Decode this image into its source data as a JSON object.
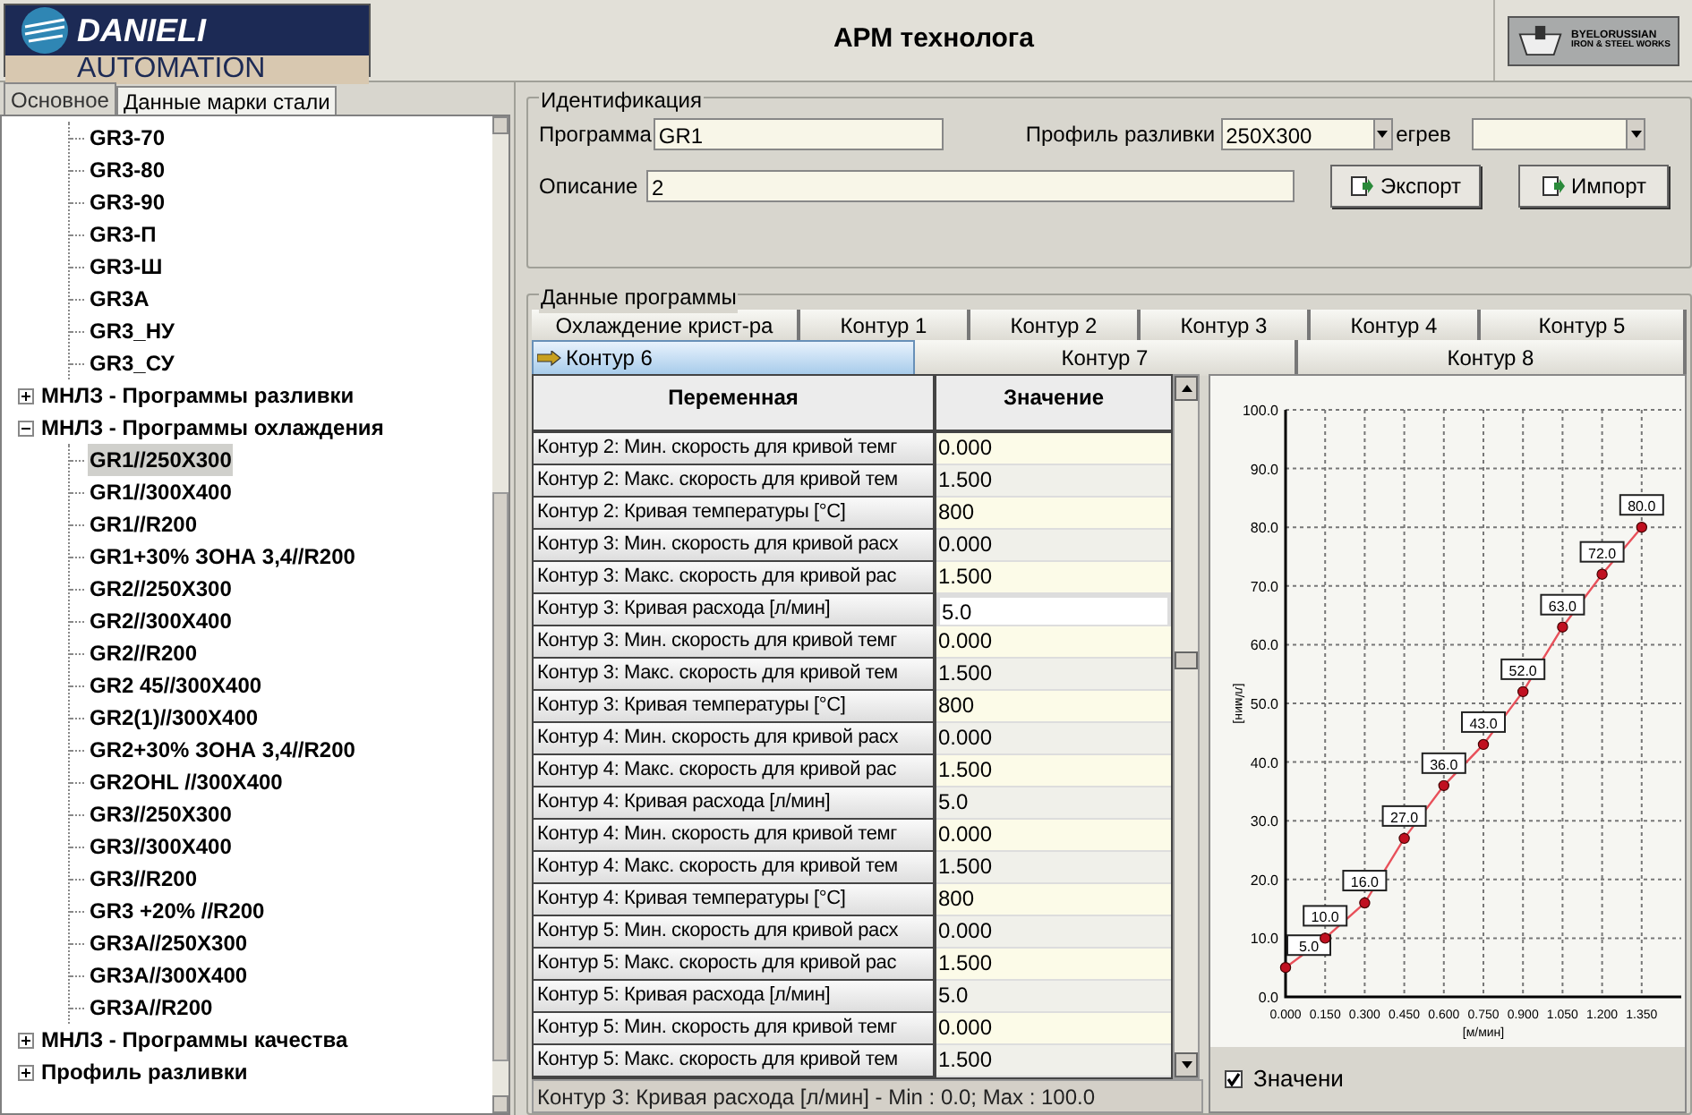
{
  "header": {
    "logo_top": "DANIELI",
    "logo_bottom": "AUTOMATION",
    "title": "АРМ технолога",
    "partner_logo": [
      "BYELORUSSIAN",
      "IRON & STEEL WORKS"
    ]
  },
  "left_tabs": [
    {
      "label": "Основное",
      "selected": true
    },
    {
      "label": "Данные марки стали",
      "selected": false
    }
  ],
  "tree": {
    "continued_children": [
      {
        "label": "GR3-70",
        "selected": false
      },
      {
        "label": "GR3-80",
        "selected": false
      },
      {
        "label": "GR3-90",
        "selected": false
      },
      {
        "label": "GR3-П",
        "selected": false
      },
      {
        "label": "GR3-Ш",
        "selected": false
      },
      {
        "label": "GR3A",
        "selected": false
      },
      {
        "label": "GR3_НУ",
        "selected": false
      },
      {
        "label": "GR3_СУ",
        "selected": false
      }
    ],
    "nodes": [
      {
        "label": "МНЛЗ - Программы разливки",
        "expanded": false
      },
      {
        "label": "МНЛЗ - Программы охлаждения",
        "expanded": true,
        "children": [
          {
            "label": "GR1//250X300",
            "selected": true
          },
          {
            "label": "GR1//300X400",
            "selected": false
          },
          {
            "label": "GR1//R200",
            "selected": false
          },
          {
            "label": "GR1+30% ЗОНА 3,4//R200",
            "selected": false
          },
          {
            "label": "GR2//250X300",
            "selected": false
          },
          {
            "label": "GR2//300X400",
            "selected": false
          },
          {
            "label": "GR2//R200",
            "selected": false
          },
          {
            "label": "GR2 45//300X400",
            "selected": false
          },
          {
            "label": "GR2(1)//300X400",
            "selected": false
          },
          {
            "label": "GR2+30% ЗОНА 3,4//R200",
            "selected": false
          },
          {
            "label": "GR2OHL //300X400",
            "selected": false
          },
          {
            "label": "GR3//250X300",
            "selected": false
          },
          {
            "label": "GR3//300X400",
            "selected": false
          },
          {
            "label": "GR3//R200",
            "selected": false
          },
          {
            "label": "GR3 +20% //R200",
            "selected": false
          },
          {
            "label": "GR3A//250X300",
            "selected": false
          },
          {
            "label": "GR3A//300X400",
            "selected": false
          },
          {
            "label": "GR3A//R200",
            "selected": false
          }
        ]
      },
      {
        "label": "МНЛЗ - Программы качества",
        "expanded": false
      },
      {
        "label": "Профиль разливки",
        "expanded": false
      }
    ]
  },
  "identification": {
    "title": "Идентификация",
    "program_label": "Программа",
    "program": "GR1",
    "profile_label": "Профиль разливки",
    "profile": "250X300",
    "heating_label": "егрев",
    "description_label": "Описание",
    "description": "2",
    "buttons": [
      "Экспорт",
      "Импорт"
    ]
  },
  "program_data": {
    "title": "Данные программы",
    "tab_rows": [
      [
        {
          "label": "Охлаждение крист-ра",
          "selected": false
        },
        {
          "label": "Контур 1",
          "selected": false
        },
        {
          "label": "Контур 2",
          "selected": false
        },
        {
          "label": "Контур 3",
          "selected": false
        },
        {
          "label": "Контур 4",
          "selected": false
        },
        {
          "label": "Контур 5",
          "selected": false
        }
      ],
      [
        {
          "label": "Контур 6",
          "selected": true
        },
        {
          "label": "Контур 7",
          "selected": false
        },
        {
          "label": "Контур 8",
          "selected": false
        }
      ]
    ],
    "table": {
      "columns": [
        "Переменная",
        "Значение"
      ],
      "rows": [
        {
          "variable": "Контур 2: Мин. скорость для кривой темг",
          "value": "0.000",
          "selected": false
        },
        {
          "variable": "Контур 2: Макс. скорость для кривой тем",
          "value": "1.500",
          "selected": false
        },
        {
          "variable": "Контур 2: Кривая температуры [°C]",
          "value": "800",
          "selected": false
        },
        {
          "variable": "Контур 3: Мин. скорость для кривой расх",
          "value": "0.000",
          "selected": false
        },
        {
          "variable": "Контур 3: Макс. скорость для кривой рас",
          "value": "1.500",
          "selected": false
        },
        {
          "variable": "Контур 3: Кривая расхода [л/мин]",
          "value": "5.0",
          "selected": true
        },
        {
          "variable": "Контур 3: Мин. скорость для кривой темг",
          "value": "0.000",
          "selected": false
        },
        {
          "variable": "Контур 3: Макс. скорость для кривой тем",
          "value": "1.500",
          "selected": false
        },
        {
          "variable": "Контур 3: Кривая температуры [°C]",
          "value": "800",
          "selected": false
        },
        {
          "variable": "Контур 4: Мин. скорость для кривой расх",
          "value": "0.000",
          "selected": false
        },
        {
          "variable": "Контур 4: Макс. скорость для кривой рас",
          "value": "1.500",
          "selected": false
        },
        {
          "variable": "Контур 4: Кривая расхода [л/мин]",
          "value": "5.0",
          "selected": false
        },
        {
          "variable": "Контур 4: Мин. скорость для кривой темг",
          "value": "0.000",
          "selected": false
        },
        {
          "variable": "Контур 4: Макс. скорость для кривой тем",
          "value": "1.500",
          "selected": false
        },
        {
          "variable": "Контур 4: Кривая температуры [°C]",
          "value": "800",
          "selected": false
        },
        {
          "variable": "Контур 5: Мин. скорость для кривой расх",
          "value": "0.000",
          "selected": false
        },
        {
          "variable": "Контур 5: Макс. скорость для кривой рас",
          "value": "1.500",
          "selected": false
        },
        {
          "variable": "Контур 5: Кривая расхода [л/мин]",
          "value": "5.0",
          "selected": false
        },
        {
          "variable": "Контур 5: Мин. скорость для кривой темг",
          "value": "0.000",
          "selected": false
        },
        {
          "variable": "Контур 5: Макс. скорость для кривой тем",
          "value": "1.500",
          "selected": false
        }
      ],
      "status": "Контур 3: Кривая расхода [л/мин] - Min : 0.0; Max : 100.0"
    },
    "chart_data": {
      "type": "line",
      "xlabel": "[м/мин]",
      "ylabel": "[л/мин]",
      "x": [
        0,
        0.15,
        0.3,
        0.45,
        0.6,
        0.75,
        0.9,
        1.05,
        1.2,
        1.35
      ],
      "series": [
        {
          "color": "#e8505a",
          "marker": "circle",
          "values": [
            5,
            10,
            16,
            27,
            36,
            43,
            52,
            63,
            72,
            80
          ]
        }
      ],
      "xlim": [
        0,
        1.5
      ],
      "ylim": [
        0,
        100
      ],
      "grid": true,
      "xticks": [
        {
          "value": 0,
          "label": "0.000"
        },
        {
          "value": 0.15,
          "label": "0.150"
        },
        {
          "value": 0.3,
          "label": "0.300"
        },
        {
          "value": 0.45,
          "label": "0.450"
        },
        {
          "value": 0.6,
          "label": "0.600"
        },
        {
          "value": 0.75,
          "label": "0.750"
        },
        {
          "value": 0.9,
          "label": "0.900"
        },
        {
          "value": 1.05,
          "label": "1.050"
        },
        {
          "value": 1.2,
          "label": "1.200"
        },
        {
          "value": 1.35,
          "label": "1.350"
        }
      ],
      "yticks": [
        {
          "value": 0,
          "label": "0.0"
        },
        {
          "value": 10,
          "label": "10.0"
        },
        {
          "value": 20,
          "label": "20.0"
        },
        {
          "value": 30,
          "label": "30.0"
        },
        {
          "value": 40,
          "label": "40.0"
        },
        {
          "value": 50,
          "label": "50.0"
        },
        {
          "value": 60,
          "label": "60.0"
        },
        {
          "value": 70,
          "label": "70.0"
        },
        {
          "value": 80,
          "label": "80.0"
        },
        {
          "value": 90,
          "label": "90.0"
        },
        {
          "value": 100,
          "label": "100.0"
        }
      ],
      "value_labels": [
        "5.0",
        "10.0",
        "16.0",
        "27.0",
        "36.0",
        "43.0",
        "52.0",
        "63.0",
        "72.0",
        "80.0"
      ]
    },
    "values_checkbox": {
      "label": "Значени",
      "checked": true
    }
  }
}
